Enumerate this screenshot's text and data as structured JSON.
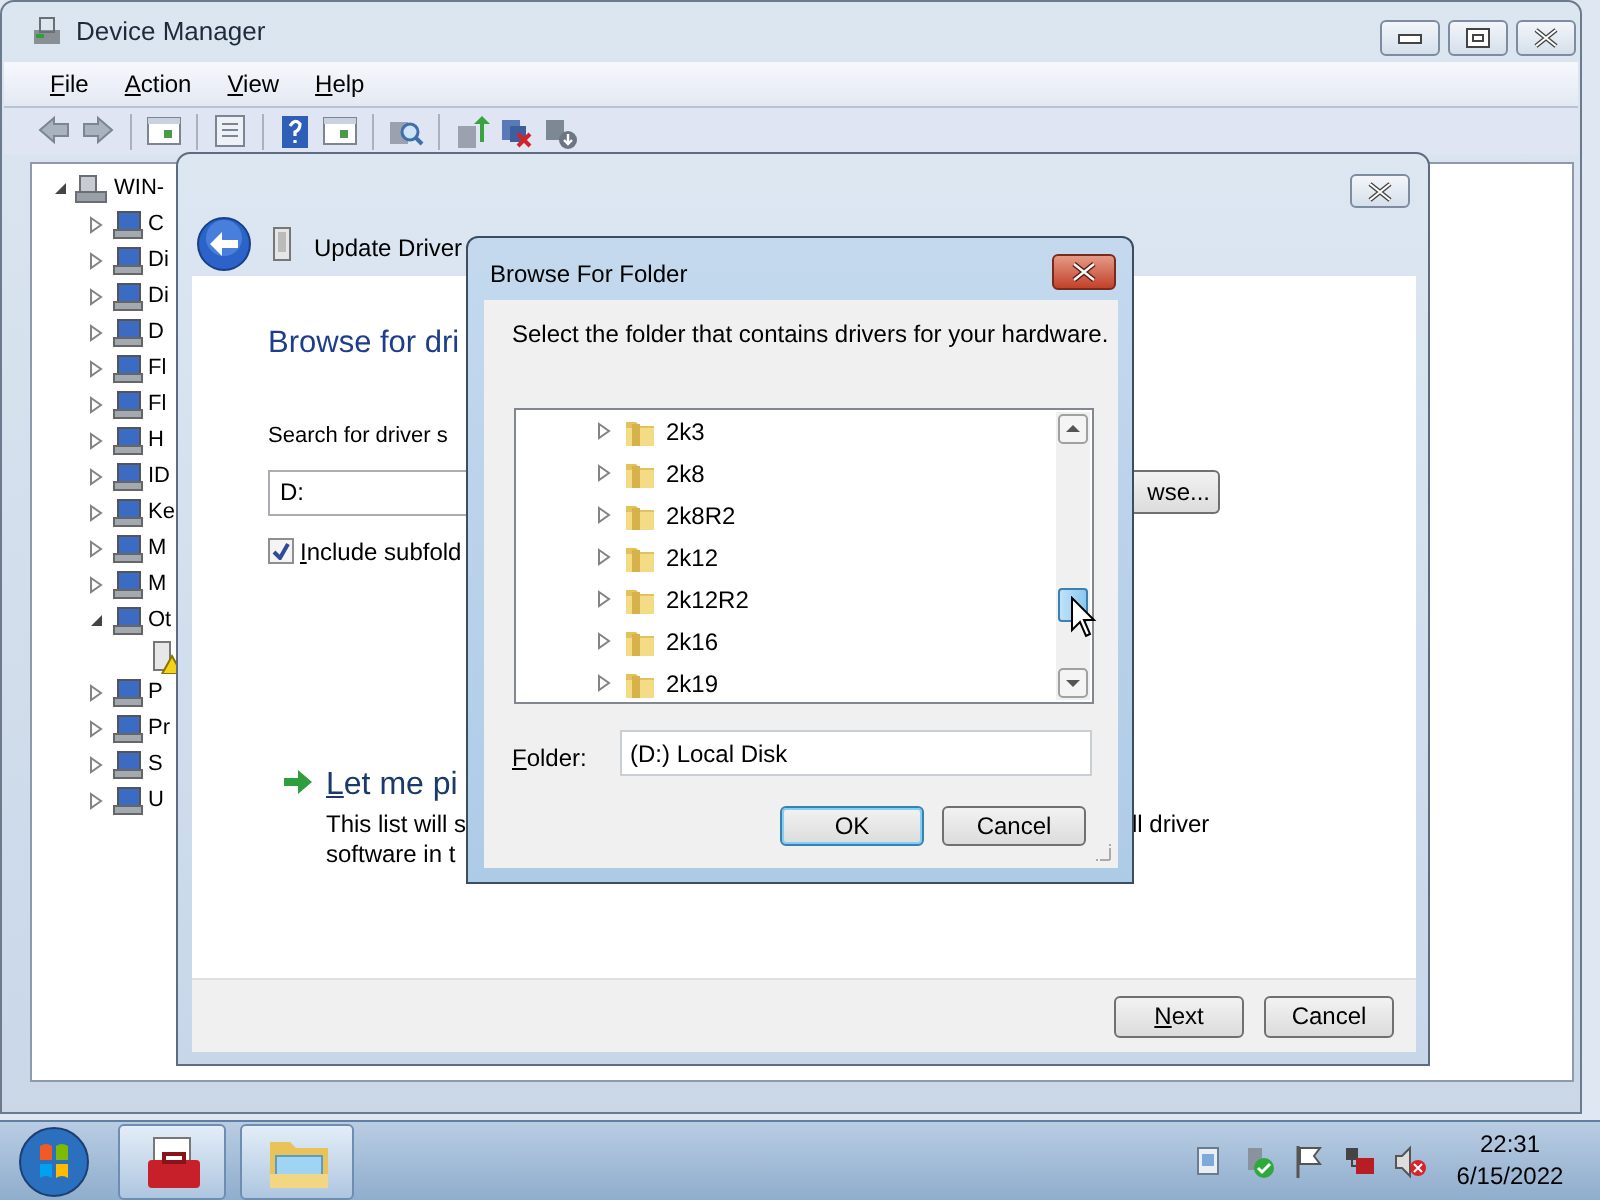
{
  "device_manager": {
    "title": "Device Manager",
    "menu": [
      "File",
      "Action",
      "View",
      "Help"
    ],
    "tree": {
      "label": "WIN-",
      "expanded": true,
      "children": [
        {
          "label": "C",
          "expanded": false
        },
        {
          "label": "Di",
          "expanded": false
        },
        {
          "label": "Di",
          "expanded": false
        },
        {
          "label": "D",
          "expanded": false
        },
        {
          "label": "Fl",
          "expanded": false
        },
        {
          "label": "Fl",
          "expanded": false
        },
        {
          "label": "H",
          "expanded": false
        },
        {
          "label": "ID",
          "expanded": false
        },
        {
          "label": "Ke",
          "expanded": false
        },
        {
          "label": "M",
          "expanded": false
        },
        {
          "label": "M",
          "expanded": false
        },
        {
          "label": "Ot",
          "expanded": true,
          "children": [
            {
              "kind": "unknown-device"
            }
          ]
        },
        {
          "label": "P",
          "expanded": false
        },
        {
          "label": "Pr",
          "expanded": false
        },
        {
          "label": "S",
          "expanded": false
        },
        {
          "label": "U",
          "expanded": false
        }
      ]
    }
  },
  "wizard": {
    "title": "Update Driver",
    "heading": "Browse for dri",
    "search_label": "Search for driver s",
    "path_value": "D:",
    "browse_button": "wse...",
    "include_subfolders": {
      "label": "Include subfold",
      "checked": true
    },
    "pick_option": {
      "title": "Let me pi",
      "description_lines": [
        "This list will s",
        "software in t"
      ],
      "description_right": "ll driver"
    },
    "buttons": [
      "Next",
      "Cancel"
    ]
  },
  "browse_dialog": {
    "title": "Browse For Folder",
    "instruction": "Select the folder that contains drivers for your hardware.",
    "folders": [
      {
        "label": "2k3",
        "expanded": false
      },
      {
        "label": "2k8",
        "expanded": false
      },
      {
        "label": "2k8R2",
        "expanded": false
      },
      {
        "label": "2k12",
        "expanded": false
      },
      {
        "label": "2k12R2",
        "expanded": false
      },
      {
        "label": "2k16",
        "expanded": false
      },
      {
        "label": "2k19",
        "expanded": false
      }
    ],
    "folder_label": "Folder:",
    "folder_value": "(D:) Local Disk",
    "buttons": [
      {
        "label": "OK",
        "default": true
      },
      {
        "label": "Cancel",
        "default": false
      }
    ]
  },
  "taskbar": {
    "time": "22:31",
    "date": "6/15/2022"
  }
}
